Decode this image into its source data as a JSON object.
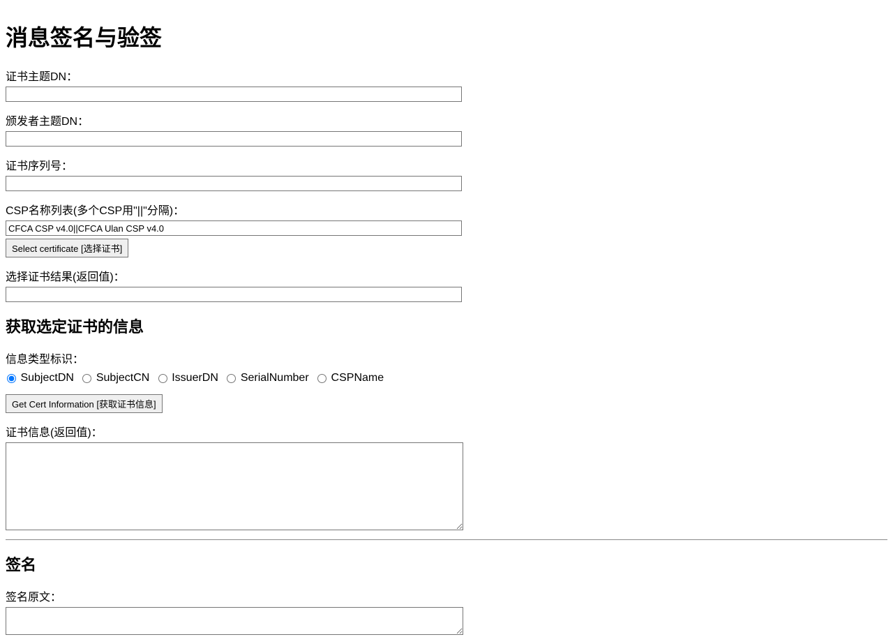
{
  "page": {
    "title": "消息签名与验签"
  },
  "cert_select": {
    "subject_dn_label": "证书主题DN：",
    "subject_dn_value": "",
    "issuer_dn_label": "颁发者主题DN：",
    "issuer_dn_value": "",
    "serial_label": "证书序列号：",
    "serial_value": "",
    "csp_list_label": "CSP名称列表(多个CSP用\"||\"分隔)：",
    "csp_list_value": "CFCA CSP v4.0||CFCA Ulan CSP v4.0",
    "select_button": "Select certificate [选择证书]",
    "result_label": "选择证书结果(返回值)：",
    "result_value": ""
  },
  "cert_info": {
    "heading": "获取选定证书的信息",
    "type_label": "信息类型标识：",
    "radios": {
      "subject_dn": "SubjectDN",
      "subject_cn": "SubjectCN",
      "issuer_dn": "IssuerDN",
      "serial_number": "SerialNumber",
      "csp_name": "CSPName"
    },
    "get_button": "Get Cert Information [获取证书信息]",
    "result_label": "证书信息(返回值)：",
    "result_value": ""
  },
  "sign": {
    "heading": "签名",
    "source_label": "签名原文：",
    "source_value": ""
  }
}
